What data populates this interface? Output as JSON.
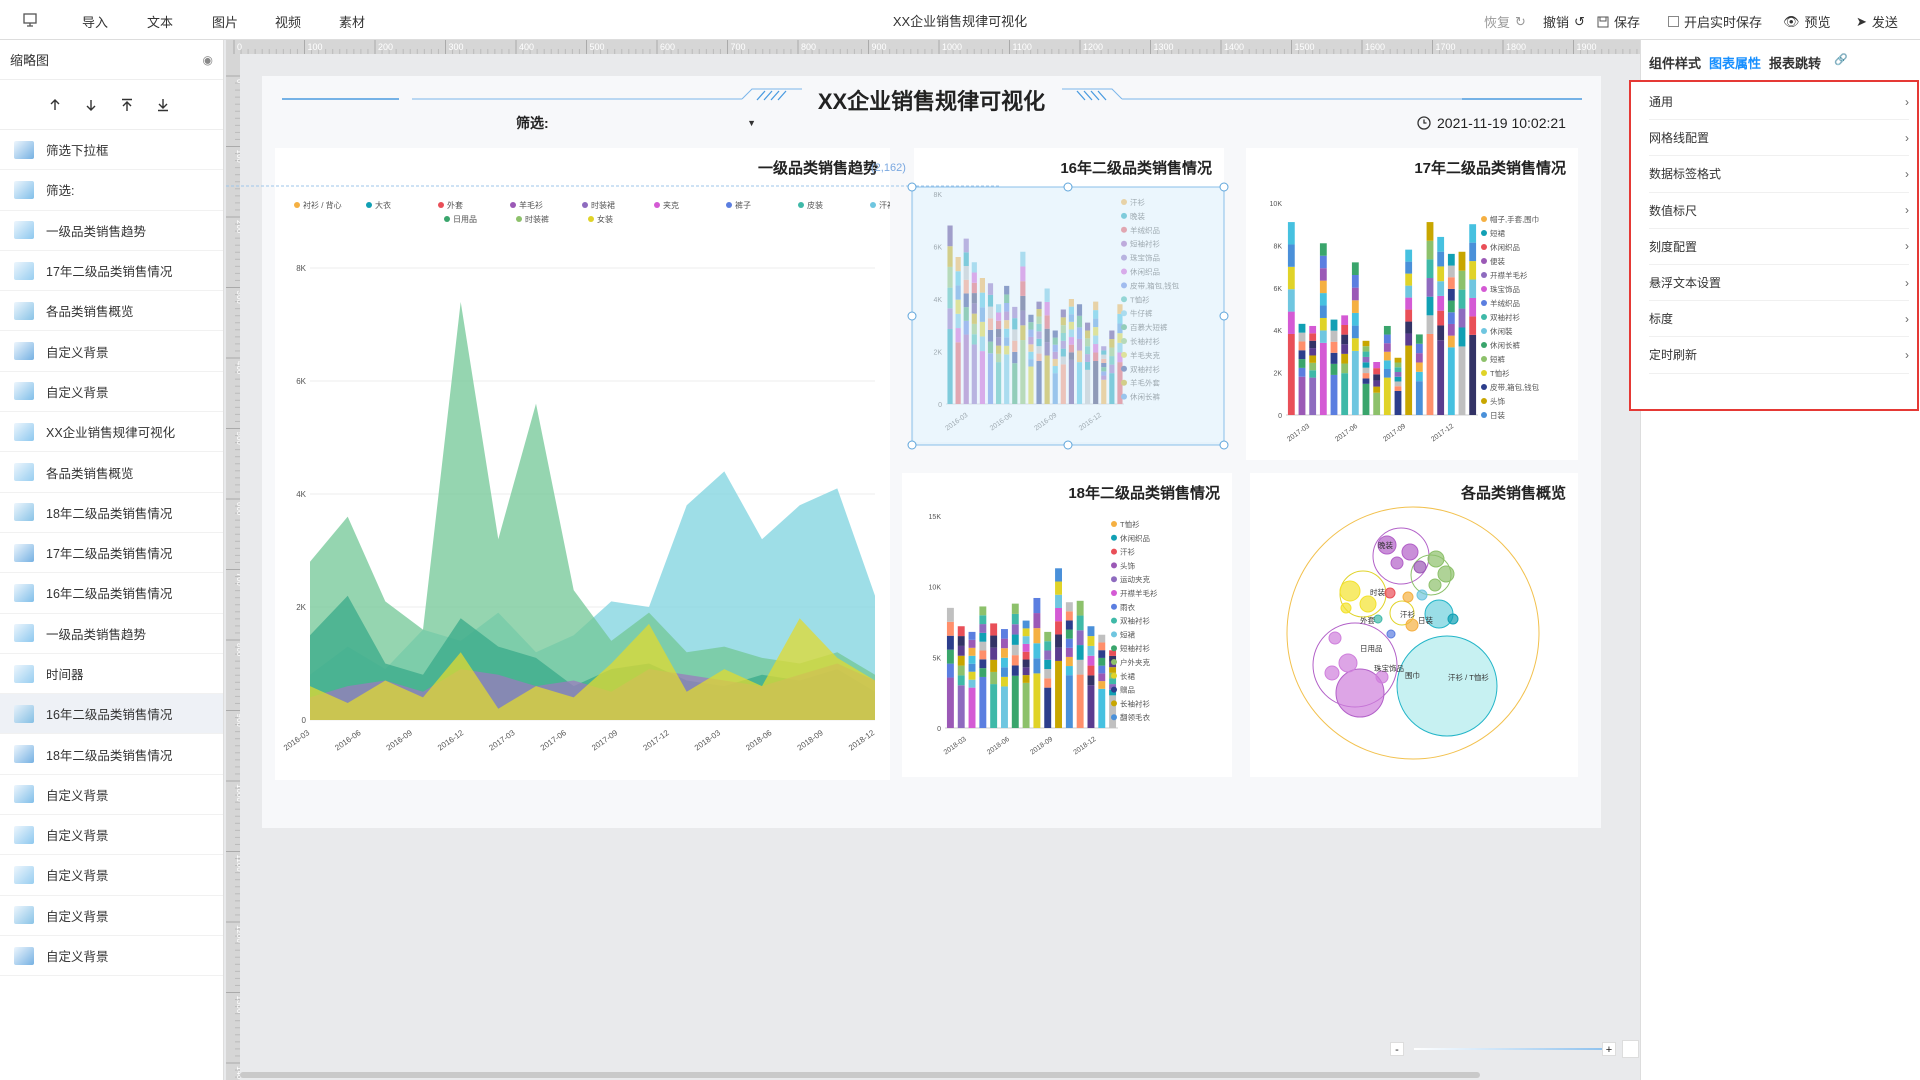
{
  "toolbar": {
    "import": "导入",
    "text": "文本",
    "image": "图片",
    "video": "视频",
    "material": "素材",
    "title": "XX企业销售规律可视化",
    "restore": "恢复",
    "undo": "撤销",
    "save": "保存",
    "autosave": "开启实时保存",
    "preview": "预览",
    "publish": "发送"
  },
  "left_panel": {
    "title": "缩略图",
    "layers": [
      "筛选下拉框",
      "筛选:",
      "一级品类销售趋势",
      "17年二级品类销售情况",
      "各品类销售概览",
      "自定义背景",
      "自定义背景",
      "XX企业销售规律可视化",
      "各品类销售概览",
      "18年二级品类销售情况",
      "17年二级品类销售情况",
      "16年二级品类销售情况",
      "一级品类销售趋势",
      "时间器",
      "16年二级品类销售情况",
      "18年二级品类销售情况",
      "自定义背景",
      "自定义背景",
      "自定义背景",
      "自定义背景",
      "自定义背景"
    ],
    "active_index": 14
  },
  "ruler": {
    "ticks": [
      "0",
      "100",
      "200",
      "300",
      "400",
      "500",
      "600",
      "700",
      "800",
      "900",
      "1000",
      "1100",
      "1200",
      "1300",
      "1400",
      "1500",
      "1600",
      "1700",
      "1800",
      "1900"
    ]
  },
  "dashboard": {
    "title": "XX企业销售规律可视化",
    "filter_label": "筛选:",
    "datetime": "2021-11-19 10:02:21"
  },
  "right_panel": {
    "tabs": [
      "组件样式",
      "图表属性",
      "报表跳转"
    ],
    "active_tab": 1,
    "properties": [
      "通用",
      "网格线配置",
      "数据标签格式",
      "数值标尺",
      "刻度配置",
      "悬浮文本设置",
      "标度",
      "定时刷新"
    ]
  },
  "colors": {
    "accent": "#1890ff",
    "highlight_border": "#e53935"
  },
  "chart_data": [
    {
      "type": "area",
      "title": "一级品类销售趋势",
      "tooltip": "(2,162)",
      "x": [
        "2016-03",
        "2016-06",
        "2016-09",
        "2016-12",
        "2017-03",
        "2017-06",
        "2017-09",
        "2017-12",
        "2018-03",
        "2018-06",
        "2018-09",
        "2018-12"
      ],
      "ylim": [
        0,
        8000
      ],
      "yticks": [
        "0",
        "2K",
        "4K",
        "6K",
        "8K"
      ],
      "legend": [
        "衬衫 / 背心",
        "大衣",
        "外套",
        "羊毛衫",
        "时装裙",
        "夹克",
        "裤子",
        "皮装",
        "汗衫 / T恤衫",
        "日用品",
        "时装裤",
        "女装"
      ],
      "series": [
        {
          "name": "汗衫 / T恤衫",
          "color": "#7ed3df",
          "values": [
            800,
            1300,
            900,
            1600,
            1400,
            1900,
            1200,
            1500,
            2100,
            2000,
            3800,
            4400,
            3200,
            3800,
            4100,
            2200
          ]
        },
        {
          "name": "大衣",
          "color": "#72c795",
          "values": [
            2800,
            3600,
            2100,
            1600,
            7400,
            3200,
            5600,
            2300,
            1400,
            1900,
            1200,
            1300,
            1100,
            1000,
            1200,
            800
          ]
        },
        {
          "name": "日用品",
          "color": "#3aaa8a",
          "values": [
            1500,
            2200,
            1000,
            800,
            1800,
            1300,
            1100,
            600,
            900,
            1000,
            700,
            600,
            800,
            700,
            900,
            500
          ]
        },
        {
          "name": "时装裙",
          "color": "#9b7bbd",
          "values": [
            400,
            600,
            700,
            500,
            900,
            800,
            600,
            700,
            500,
            900,
            800,
            700,
            600,
            800,
            1000,
            700
          ]
        },
        {
          "name": "女装",
          "color": "#e0da30",
          "values": [
            600,
            300,
            700,
            400,
            1200,
            200,
            600,
            400,
            1000,
            1700,
            500,
            900,
            600,
            1800,
            1100,
            700
          ]
        }
      ]
    },
    {
      "type": "bar",
      "title": "16年二级品类销售情况",
      "x": [
        "2016-03",
        "2016-06",
        "2016-09",
        "2016-12"
      ],
      "ylim": [
        0,
        8000
      ],
      "yticks": [
        "0",
        "2K",
        "4K",
        "6K",
        "8K"
      ],
      "legend": [
        "汗衫",
        "晚装",
        "羊绒织品",
        "短袖衬衫",
        "珠宝饰品",
        "休闲织品",
        "皮带,箱包,钱包",
        "T恤衫",
        "牛仔裤",
        "百慕大短裤",
        "长袖衬衫",
        "羊毛夹克",
        "双袖衬衫",
        "羊毛外套",
        "休闲长裤"
      ],
      "totals": [
        6800,
        5600,
        6300,
        5400,
        4800,
        4600,
        3800,
        4500,
        3700,
        5800,
        3400,
        3900,
        4400,
        2800,
        3600,
        4000,
        3800,
        3100,
        3900,
        2200,
        2800,
        3800
      ]
    },
    {
      "type": "bar",
      "title": "17年二级品类销售情况",
      "x": [
        "2017-03",
        "2017-06",
        "2017-09",
        "2017-12"
      ],
      "ylim": [
        0,
        10000
      ],
      "yticks": [
        "0",
        "2K",
        "4K",
        "6K",
        "8K",
        "10K"
      ],
      "legend": [
        "帽子,手套,围巾",
        "短裙",
        "休闲织品",
        "便装",
        "开襟羊毛衫",
        "珠宝饰品",
        "羊绒织品",
        "双袖衬衫",
        "休闲裝",
        "休闲长裤",
        "短裤",
        "T恤衫",
        "皮带,箱包,钱包",
        "头饰",
        "日装"
      ],
      "totals": [
        9100,
        4300,
        4200,
        8100,
        4500,
        4700,
        7200,
        3500,
        2500,
        4200,
        2700,
        7800,
        3800,
        9100,
        8400,
        7600,
        7700,
        9000
      ]
    },
    {
      "type": "bar",
      "title": "18年二级品类销售情况",
      "x": [
        "2018-03",
        "2018-06",
        "2018-09",
        "2018-12"
      ],
      "ylim": [
        0,
        15000
      ],
      "yticks": [
        "0",
        "5K",
        "10K",
        "15K"
      ],
      "legend": [
        "T恤衫",
        "休闲织品",
        "汗衫",
        "头饰",
        "运动夹克",
        "开襟羊毛衫",
        "雨衣",
        "双袖衬衫",
        "短裙",
        "短袖衬衫",
        "户外夹克",
        "长裙",
        "赠品",
        "长袖衬衫",
        "翻领毛衣"
      ],
      "totals": [
        8500,
        7200,
        6800,
        8600,
        7400,
        7000,
        8800,
        7600,
        9200,
        6800,
        11300,
        8900,
        9000,
        7200,
        6600,
        5500
      ]
    },
    {
      "type": "bubble",
      "title": "各品类销售概览",
      "labels": [
        "晚装",
        "时装",
        "外套",
        "日装",
        "日用品",
        "珠宝饰品",
        "汗衫",
        "汗衫 / T恤衫",
        "围巾"
      ]
    }
  ]
}
